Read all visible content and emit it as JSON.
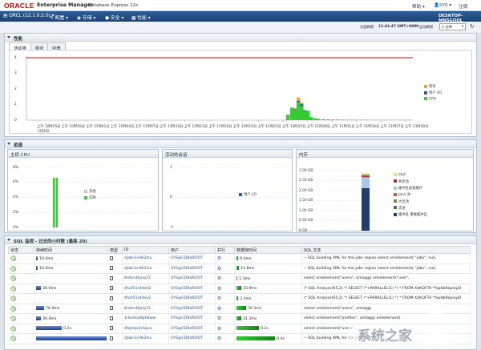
{
  "header": {
    "logo": "ORACLE",
    "product": "Enterprise Manager",
    "edition": "Database Express 12c",
    "help": "帮助",
    "user": "SYS",
    "logout": "注销"
  },
  "menu": {
    "db": "ORCL (12.1.0.2.0)",
    "items": [
      "配置",
      "存储",
      "安全",
      "性能"
    ],
    "host": "DESKTOP-MN5GQOL"
  },
  "info": {
    "time_label": "页面刷新",
    "time": "11:41:47 GMT+0800",
    "auto_label": "自动刷新",
    "auto_value": "1 分钟"
  },
  "activity": {
    "title": "性能",
    "tabs": [
      "活动类",
      "服务",
      "容器"
    ],
    "yticks": [
      "4",
      "3",
      "2",
      "1",
      "0"
    ],
    "xticks": [
      "上午 10时55分",
      "上午 10时58分",
      "上午 11时01分",
      "上午 11时04分",
      "上午 11时07分",
      "上午 11时10分",
      "上午 11时13分",
      "上午 11时16分",
      "上午 11时19分",
      "上午 11时22分",
      "上午 11时25分",
      "上午 11时28分",
      "上午 11时31分",
      "上午 11时34分",
      "上午 11时37分",
      "上午 11时40分"
    ],
    "xdate": "5月4日",
    "legend": [
      {
        "name": "等待",
        "color": "#f0a23c"
      },
      {
        "name": "用户 I/O",
        "color": "#2a5ea8"
      },
      {
        "name": "CPU",
        "color": "#33cc33"
      }
    ],
    "cpu_limit": 4
  },
  "resources": {
    "title": "资源",
    "cpu": {
      "title": "主机 CPU",
      "yticks": [
        "8%",
        "6%",
        "4%",
        "2%",
        "0%"
      ],
      "legend": [
        {
          "name": "其他",
          "color": "#dfeed8"
        },
        {
          "name": "实例",
          "color": "#33cc33"
        }
      ],
      "value": 6.2
    },
    "activity": {
      "title": "活动的会话",
      "yticks": [
        "1",
        "0",
        "-1"
      ],
      "legend": [
        {
          "name": "用户 I/O",
          "color": "#2a5ea8"
        }
      ]
    },
    "memory": {
      "title": "内存",
      "yticks": [
        "3.00 GB",
        "2.50 GB",
        "2.00 GB",
        "1.50 GB",
        "1.00 GB",
        "0.50 GB",
        "0 GB"
      ],
      "legend": [
        {
          "name": "PGA",
          "color": "#f2d888"
        },
        {
          "name": "共享池",
          "color": "#b82b2b"
        },
        {
          "name": "缓冲区高速缓存",
          "color": "#a8c8ea"
        },
        {
          "name": "Java 池",
          "color": "#c85a3b"
        },
        {
          "name": "大型池",
          "color": "#6e8c3a"
        },
        {
          "name": "流池",
          "color": "#3f7e5c"
        },
        {
          "name": "缓冲区 重做缓冲区",
          "color": "#1d3f6e"
        }
      ],
      "values": [
        2.12,
        0.05,
        0.6,
        0.05,
        0.03,
        0.02,
        0.06
      ]
    }
  },
  "sql": {
    "title": "SQL 监视 - 过去的小时数 (最高 20)",
    "columns": [
      "状态",
      "持续时间",
      "类型",
      "ID",
      "用户",
      "并行",
      "数据库时间",
      "SQL 文本"
    ],
    "rows": [
      {
        "dur": "10.0ms",
        "id": "djabn1n9k2tru",
        "user": "SYS@CDB$ROOT",
        "dbt": "9.4ms",
        "sql": "-- SQL building XML for the jobs region     select     xmlelement(     \"jobs\",     null,"
      },
      {
        "dur": "10.0ms",
        "id": "djabn1n9k2tru",
        "user": "SYS@CDB$ROOT",
        "dbt": "11.8ms",
        "sql": "-- SQL building XML for the jobs region     select     xmlelement(     \"jobs\",     null,"
      },
      {
        "dur": "",
        "id": "8rzbn4fpnq72",
        "user": "SYS@CDB$ROOT",
        "dbt": "1.3ms",
        "sql": "select        xmlelement(\"users\",        xmlagg(          xmlelement(\"user\","
      },
      {
        "dur": "30.0ms",
        "id": "4fu051rdded2",
        "user": "SYS@CDB$ROOT",
        "dbt": "33.9ms",
        "sql": "/* SQL Analyze(65,2) */ SELECT /*+PARALLEL(1) */ * FROM X$KQFTA *%pdbReplayD"
      },
      {
        "dur": "",
        "id": "4fu051rdded2",
        "user": "SYS@CDB$ROOT",
        "dbt": "3.3ms",
        "sql": "/* SQL Analyze(65,2) */ SELECT /*+PARALLEL(1) */ * FROM X$KQFTA *%pdbReplayD"
      },
      {
        "dur": "70.0ms",
        "id": "8rzbn4fpnq72",
        "user": "SYS@CDB$ROOT",
        "dbt": "76.1ms",
        "sql": "select        xmlelement(\"users\",        xmlagg("
      },
      {
        "dur": "30.0ms",
        "id": "1r8u0ua9ph8ww",
        "user": "SYS@CDB$ROOT",
        "dbt": "31.2ms",
        "sql": "select xmlelement(\"profiles\",       xmlagg(   xmlelement("
      },
      {
        "dur": "0.2s",
        "id": "4fqmqx2rSqva",
        "user": "SYS@CDB$ROOT",
        "dbt": "0.2s",
        "sql": "select        xmlelement(\"users\","
      },
      {
        "dur": "1.0s",
        "id": "djabn1n9k2tru",
        "user": "SYS@CDB$ROOT",
        "dbt": "0.4s",
        "sql": "-- SQL building XML for the jobs region"
      }
    ]
  },
  "colors": {
    "menu": "#1c4274",
    "cpu_green": "#33cc33",
    "limit_red": "#d90000",
    "user_io": "#2a5ea8",
    "wait": "#f0a23c"
  }
}
